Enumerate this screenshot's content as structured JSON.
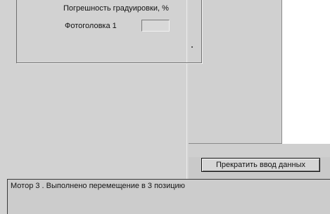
{
  "calibration_panel": {
    "error_label": "Погрешность градуировки, %",
    "photohead_label": "Фотоголовка 1",
    "photohead_value": ""
  },
  "actions": {
    "stop_input_label": "Прекратить ввод данных"
  },
  "status": {
    "message": "Мотор 3 . Выполнено перемещение в 3 позицию"
  }
}
